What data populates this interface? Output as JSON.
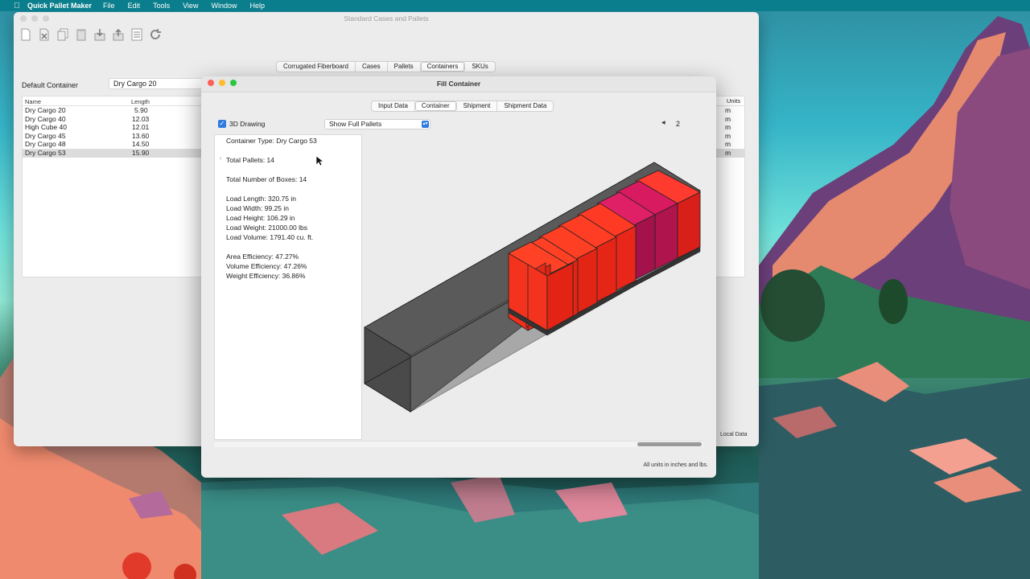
{
  "menubar": {
    "app_name": "Quick Pallet Maker",
    "items": [
      "File",
      "Edit",
      "Tools",
      "View",
      "Window",
      "Help"
    ]
  },
  "back_window": {
    "title": "Standard Cases and Pallets",
    "tabs": [
      "Corrugated Fiberboard",
      "Cases",
      "Pallets",
      "Containers",
      "SKUs"
    ],
    "active_tab": "Containers",
    "default_container_label": "Default Container",
    "default_container_value": "Dry Cargo 20",
    "columns": [
      "Name",
      "Length"
    ],
    "units_column": "Units",
    "rows": [
      {
        "name": "Dry Cargo 20",
        "length": "5.90",
        "units": "m"
      },
      {
        "name": "Dry Cargo 40",
        "length": "12.03",
        "units": "m"
      },
      {
        "name": "High Cube 40",
        "length": "12.01",
        "units": "m"
      },
      {
        "name": "Dry Cargo 45",
        "length": "13.60",
        "units": "m"
      },
      {
        "name": "Dry Cargo 48",
        "length": "14.50",
        "units": "m"
      },
      {
        "name": "Dry Cargo 53",
        "length": "15.90",
        "units": "m"
      }
    ],
    "selected_row": 5,
    "status": "Local Data"
  },
  "front_window": {
    "title": "Fill Container",
    "tabs": [
      "Input Data",
      "Container",
      "Shipment",
      "Shipment Data"
    ],
    "active_tab": "Container",
    "drawing_label": "3D Drawing",
    "drawing_checked": true,
    "display_mode": "Show Full Pallets",
    "page_number": "2",
    "info": {
      "container_type": "Container Type: Dry Cargo 53",
      "total_pallets": "Total Pallets: 14",
      "total_boxes": "Total Number of Boxes: 14",
      "load_length": "Load Length: 320.75 in",
      "load_width": "Load Width: 99.25 in",
      "load_height": "Load Height: 106.29 in",
      "load_weight": "Load Weight: 21000.00 lbs",
      "load_volume": "Load Volume: 1791.40 cu. ft.",
      "area_efficiency": "Area Efficiency: 47.27%",
      "volume_efficiency": "Volume Efficiency: 47.26%",
      "weight_efficiency": "Weight Efficiency: 36.86%"
    },
    "footer_note": "All units in inches and lbs.",
    "colors": {
      "container_floor": "#555555",
      "pallet_red": "#e8261a",
      "pallet_magenta": "#c2185b"
    }
  }
}
